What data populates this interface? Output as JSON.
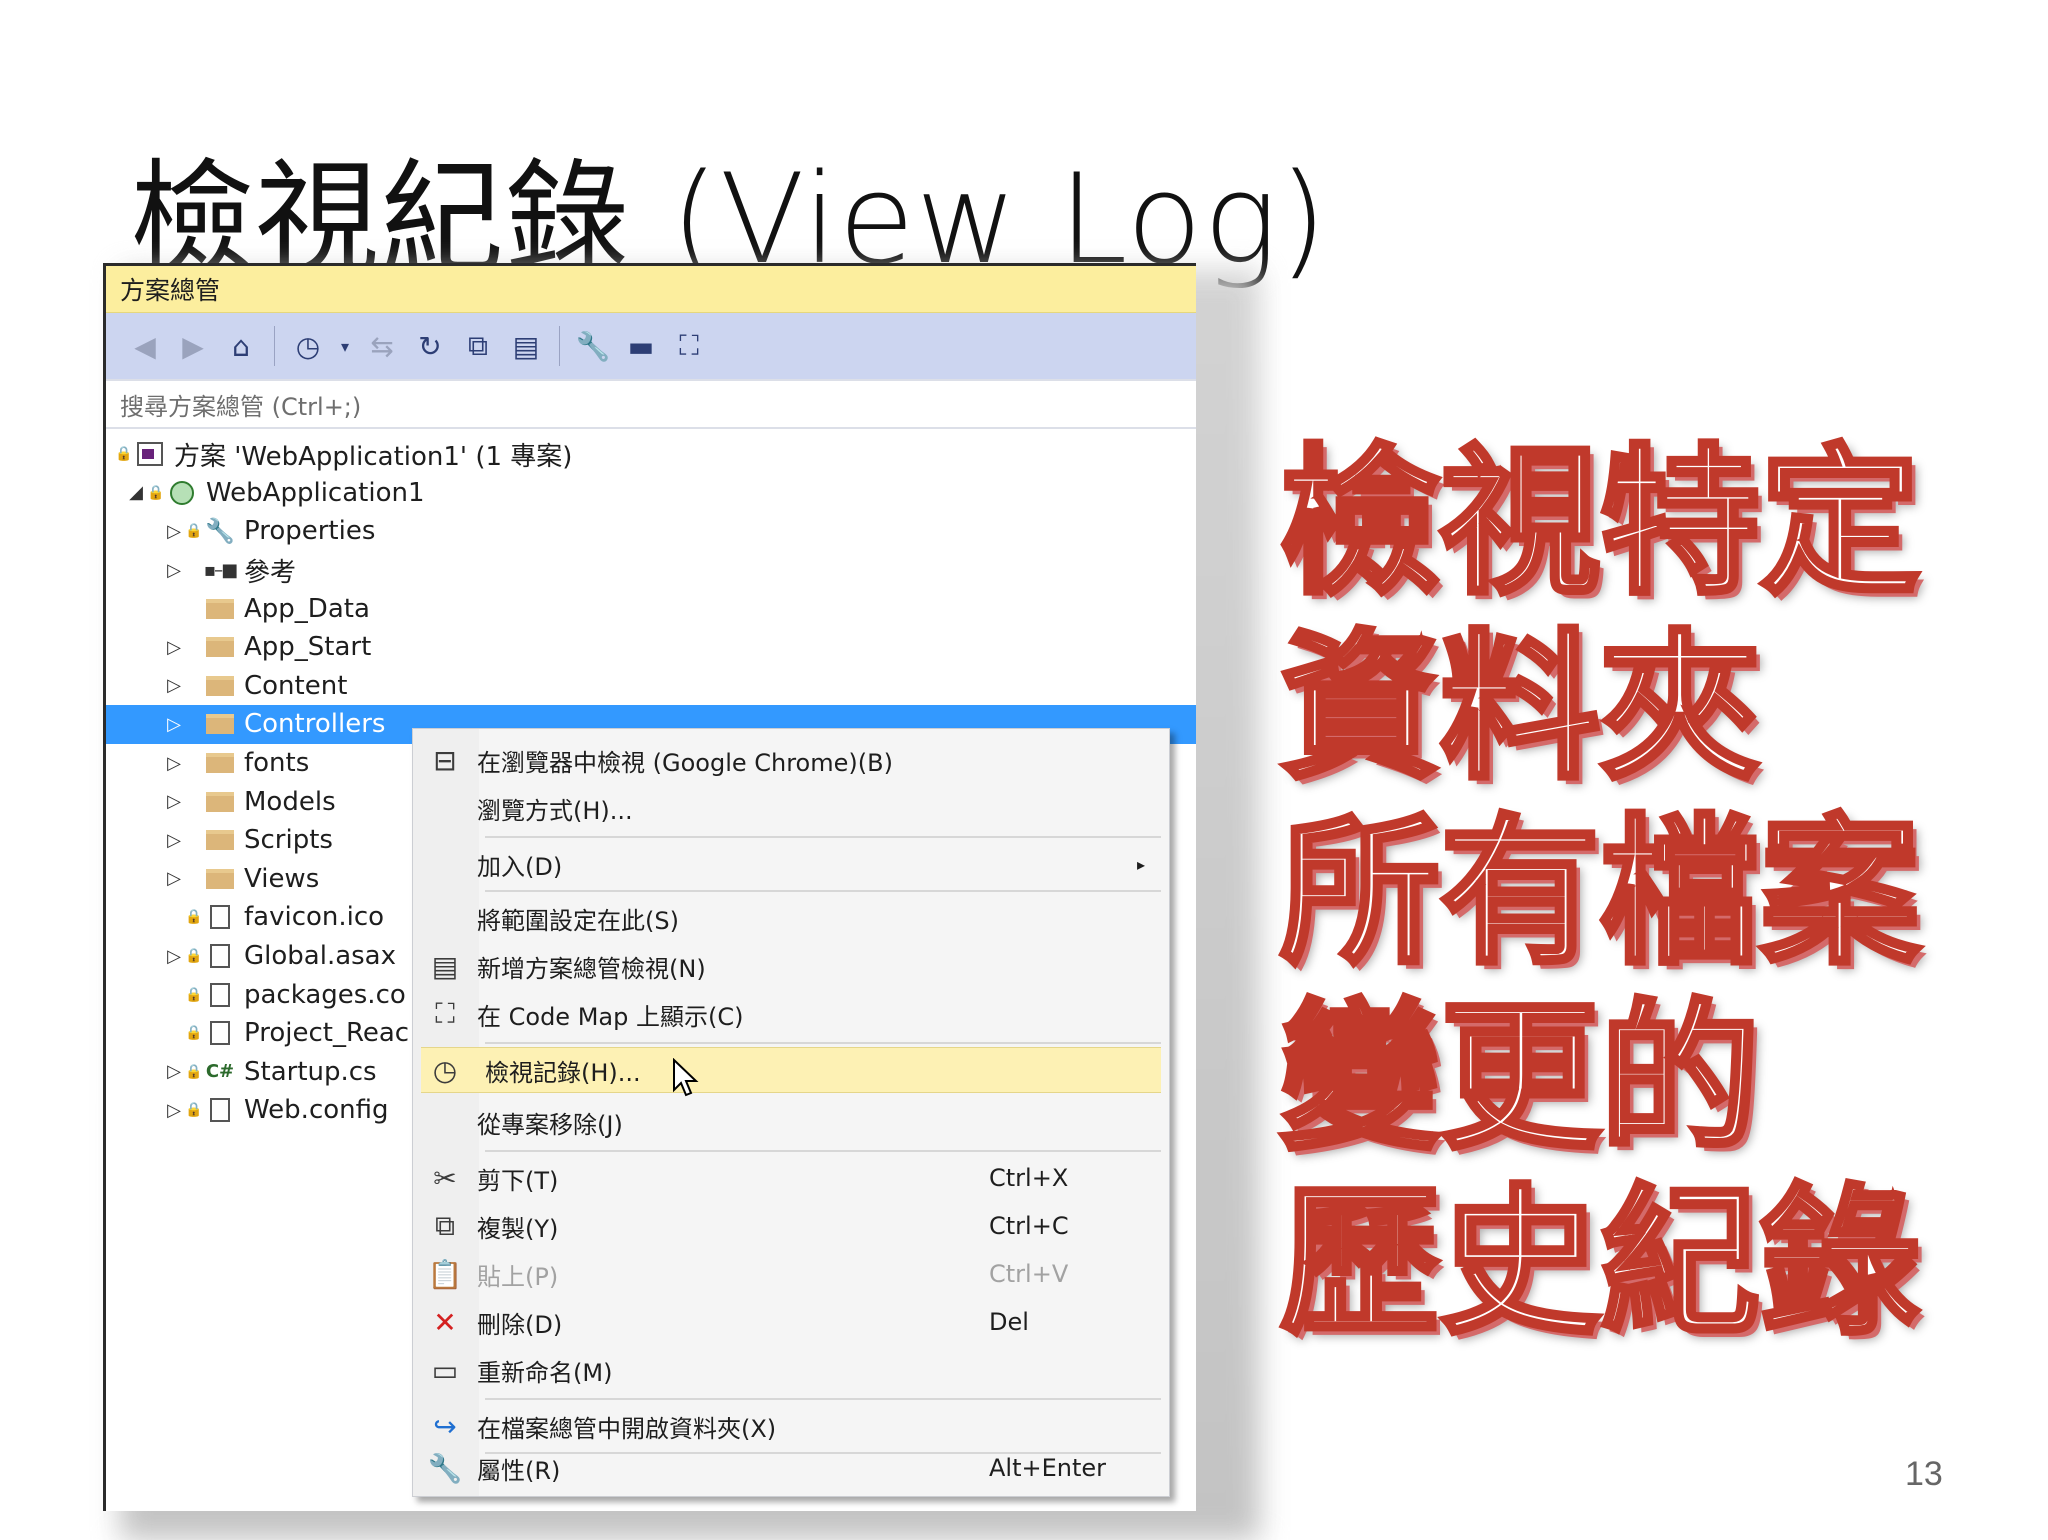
{
  "slide": {
    "title": "檢視紀錄 (View Log)",
    "side_lines": [
      "檢視特定",
      "資料夾",
      "所有檔案",
      "變更的",
      "歷史紀錄"
    ],
    "page_number": "13"
  },
  "solution_explorer": {
    "title": "方案總管",
    "search_placeholder": "搜尋方案總管 (Ctrl+;)",
    "toolbar_icons": [
      "back-icon",
      "forward-icon",
      "home-icon",
      "pending-changes-icon",
      "chevron-down-icon",
      "sync-icon",
      "refresh-icon",
      "collapse-all-icon",
      "show-all-files-icon",
      "properties-icon",
      "preview-icon",
      "code-map-icon"
    ],
    "tree": [
      {
        "label": "方案 'WebApplication1' (1 專案)",
        "icon": "solution-icon",
        "twisty": ""
      },
      {
        "label": "WebApplication1",
        "icon": "web-project-icon",
        "twisty": "◢"
      },
      {
        "label": "Properties",
        "icon": "wrench-icon",
        "twisty": "▷"
      },
      {
        "label": "參考",
        "icon": "references-icon",
        "twisty": "▷"
      },
      {
        "label": "App_Data",
        "icon": "folder-icon",
        "twisty": ""
      },
      {
        "label": "App_Start",
        "icon": "folder-icon",
        "twisty": "▷"
      },
      {
        "label": "Content",
        "icon": "folder-icon",
        "twisty": "▷"
      },
      {
        "label": "Controllers",
        "icon": "folder-icon",
        "twisty": "▷"
      },
      {
        "label": "fonts",
        "icon": "folder-icon",
        "twisty": "▷"
      },
      {
        "label": "Models",
        "icon": "folder-icon",
        "twisty": "▷"
      },
      {
        "label": "Scripts",
        "icon": "folder-icon",
        "twisty": "▷"
      },
      {
        "label": "Views",
        "icon": "folder-icon",
        "twisty": "▷"
      },
      {
        "label": "favicon.ico",
        "icon": "file-icon",
        "twisty": ""
      },
      {
        "label": "Global.asax",
        "icon": "file-icon",
        "twisty": "▷"
      },
      {
        "label": "packages.co",
        "icon": "file-icon",
        "twisty": ""
      },
      {
        "label": "Project_Reac",
        "icon": "file-icon",
        "twisty": ""
      },
      {
        "label": "Startup.cs",
        "icon": "csharp-icon",
        "twisty": "▷"
      },
      {
        "label": "Web.config",
        "icon": "file-icon",
        "twisty": "▷"
      }
    ],
    "selected_item": "Controllers"
  },
  "context_menu": {
    "items": [
      {
        "label": "在瀏覽器中檢視 (Google Chrome)(B)",
        "shortcut": "",
        "icon": "view-in-browser-icon"
      },
      {
        "label": "瀏覽方式(H)...",
        "shortcut": "",
        "icon": ""
      },
      {
        "label": "加入(D)",
        "shortcut": "",
        "icon": "",
        "submenu": "▸"
      },
      {
        "label": "將範圍設定在此(S)",
        "shortcut": "",
        "icon": ""
      },
      {
        "label": "新增方案總管檢視(N)",
        "shortcut": "",
        "icon": "new-view-icon"
      },
      {
        "label": "在 Code Map 上顯示(C)",
        "shortcut": "",
        "icon": "code-map-icon"
      },
      {
        "label": "檢視記錄(H)...",
        "shortcut": "",
        "icon": "history-icon"
      },
      {
        "label": "從專案移除(J)",
        "shortcut": "",
        "icon": ""
      },
      {
        "label": "剪下(T)",
        "shortcut": "Ctrl+X",
        "icon": "cut-icon"
      },
      {
        "label": "複製(Y)",
        "shortcut": "Ctrl+C",
        "icon": "copy-icon"
      },
      {
        "label": "貼上(P)",
        "shortcut": "Ctrl+V",
        "icon": "paste-icon"
      },
      {
        "label": "刪除(D)",
        "shortcut": "Del",
        "icon": "delete-icon"
      },
      {
        "label": "重新命名(M)",
        "shortcut": "",
        "icon": "rename-icon"
      },
      {
        "label": "在檔案總管中開啟資料夾(X)",
        "shortcut": "",
        "icon": "open-folder-icon"
      },
      {
        "label": "屬性(R)",
        "shortcut": "Alt+Enter",
        "icon": "properties-icon"
      }
    ],
    "hovered_item": "檢視記錄(H)...",
    "disabled_item": "貼上(P)"
  },
  "colors": {
    "title_bar": "#fcee9e",
    "toolbar": "#ccd5f0",
    "selection": "#3399ff",
    "menu_hover": "#fdf1b4",
    "side_text_outline": "#c0392b"
  }
}
